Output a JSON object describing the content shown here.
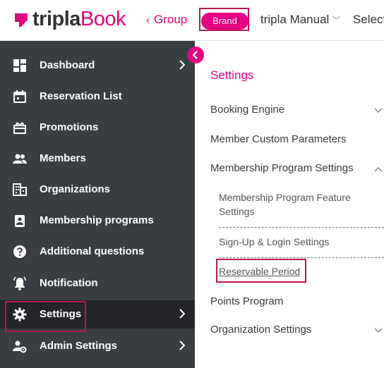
{
  "header": {
    "logo_prefix": "tripla",
    "logo_suffix": "Book",
    "group_label": "Group",
    "brand_label": "Brand",
    "manual_label": "tripla Manual",
    "select_label": "Select"
  },
  "sidebar": {
    "items": [
      {
        "label": "Dashboard",
        "icon": "dashboard-icon",
        "has_chevron": true
      },
      {
        "label": "Reservation List",
        "icon": "calendar-icon",
        "has_chevron": false
      },
      {
        "label": "Promotions",
        "icon": "gift-icon",
        "has_chevron": false
      },
      {
        "label": "Members",
        "icon": "people-icon",
        "has_chevron": false
      },
      {
        "label": "Organizations",
        "icon": "building-icon",
        "has_chevron": false
      },
      {
        "label": "Membership programs",
        "icon": "badge-icon",
        "has_chevron": false
      },
      {
        "label": "Additional questions",
        "icon": "help-icon",
        "has_chevron": false
      },
      {
        "label": "Notification",
        "icon": "bell-icon",
        "has_chevron": false
      },
      {
        "label": "Settings",
        "icon": "gear-icon",
        "has_chevron": true,
        "active": true
      },
      {
        "label": "Admin Settings",
        "icon": "admin-settings-icon",
        "has_chevron": true
      }
    ]
  },
  "main": {
    "title": "Settings",
    "booking_engine": "Booking Engine",
    "member_custom_parameters": "Member Custom Parameters",
    "membership_program_settings": "Membership Program Settings",
    "sub_feature_line1": "Membership Program Feature",
    "sub_feature_line2": "Settings",
    "sub_signup": "Sign-Up & Login Settings",
    "sub_reservable": "Reservable Period",
    "points_program": "Points Program",
    "organization_settings": "Organization Settings"
  },
  "colors": {
    "accent": "#e4007f",
    "sidebar_bg": "#3a3e43",
    "sidebar_active": "#232529",
    "highlight_border": "#b8184e"
  }
}
